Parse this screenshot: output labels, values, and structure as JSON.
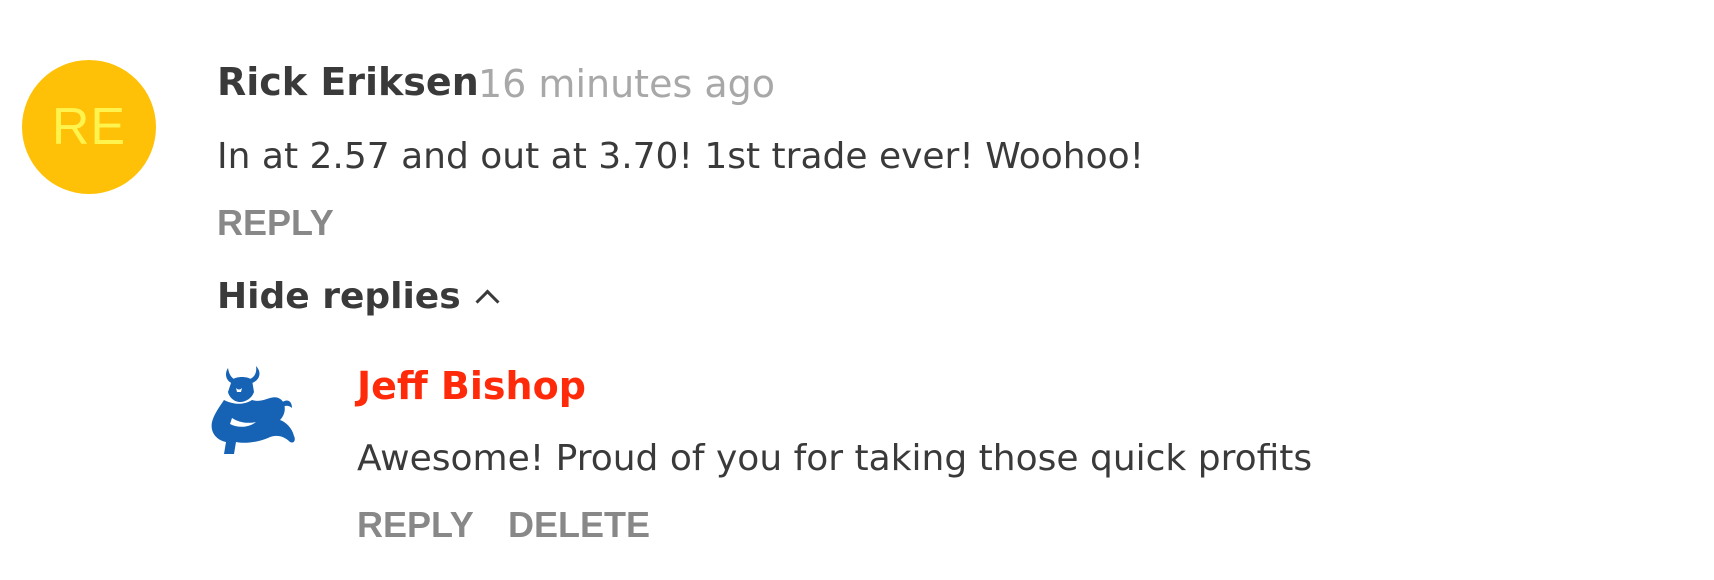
{
  "comment": {
    "avatar_initials": "RE",
    "avatar_color": "#ffc107",
    "author": "Rick Eriksen",
    "timestamp": "16 minutes ago",
    "text": "In at 2.57 and out at 3.70! 1st trade ever! Woohoo!",
    "reply_label": "REPLY",
    "toggle_replies_label": "Hide replies"
  },
  "reply": {
    "avatar_icon": "bull-logo-icon",
    "avatar_color": "#1663b5",
    "author": "Jeff Bishop",
    "author_color": "#ff2a0a",
    "text": "Awesome! Proud of you for taking those quick profits",
    "reply_label": "REPLY",
    "delete_label": "DELETE"
  }
}
